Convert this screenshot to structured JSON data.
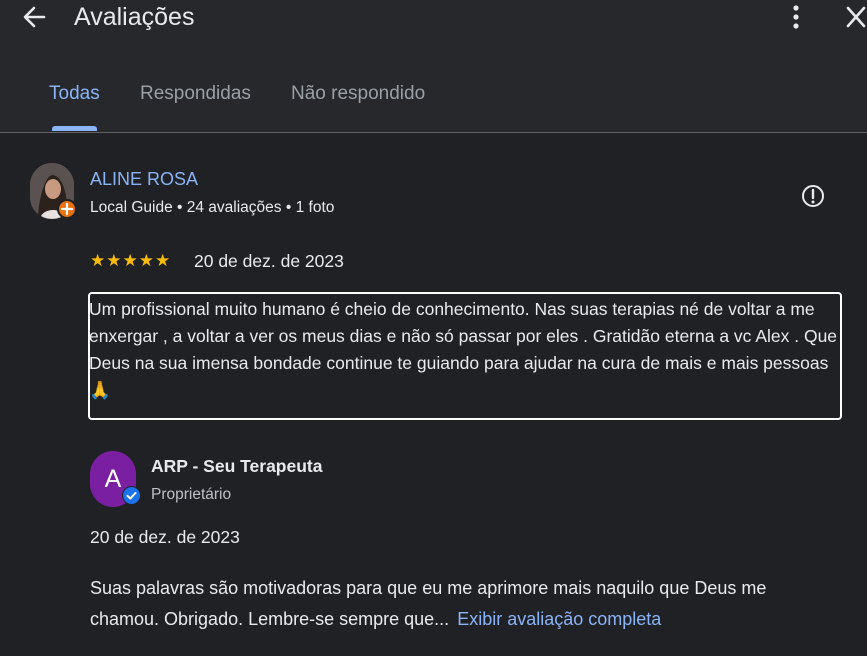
{
  "header": {
    "title": "Avaliações",
    "tabs": [
      {
        "label": "Todas",
        "active": true
      },
      {
        "label": "Respondidas",
        "active": false
      },
      {
        "label": "Não respondido",
        "active": false
      }
    ]
  },
  "review": {
    "author": "ALINE ROSA",
    "meta": "Local Guide • 24 avaliações • 1 foto",
    "stars": "★★★★★",
    "rating": 5,
    "date": "20 de dez. de 2023",
    "text": "Um profissional muito humano é cheio de conhecimento. Nas suas terapias né de voltar a me enxergar , a voltar a ver os meus dias e não só passar por eles . Gratidão eterna a vc Alex . Que Deus na sua imensa bondade continue te guiando para ajudar na cura de mais e mais pessoas 🙏"
  },
  "reply": {
    "avatar_letter": "A",
    "owner_name": "ARP - Seu Terapeuta",
    "owner_role": "Proprietário",
    "date": "20 de dez. de 2023",
    "text": "Suas palavras são motivadoras para que eu me aprimore mais naquilo que Deus me chamou. Obrigado. Lembre-se sempre que...",
    "link_label": "Exibir avaliação completa"
  },
  "colors": {
    "background": "#202124",
    "header": "#27282b",
    "accent": "#8ab4f8",
    "star": "#fbbc04",
    "owner_avatar": "#7b1fa2",
    "local_guide_badge": "#e8710a"
  },
  "icons": {
    "back": "arrow-back-icon",
    "more": "more-vert-icon",
    "close": "close-icon",
    "report": "report-icon",
    "verified": "verified-badge-icon"
  }
}
